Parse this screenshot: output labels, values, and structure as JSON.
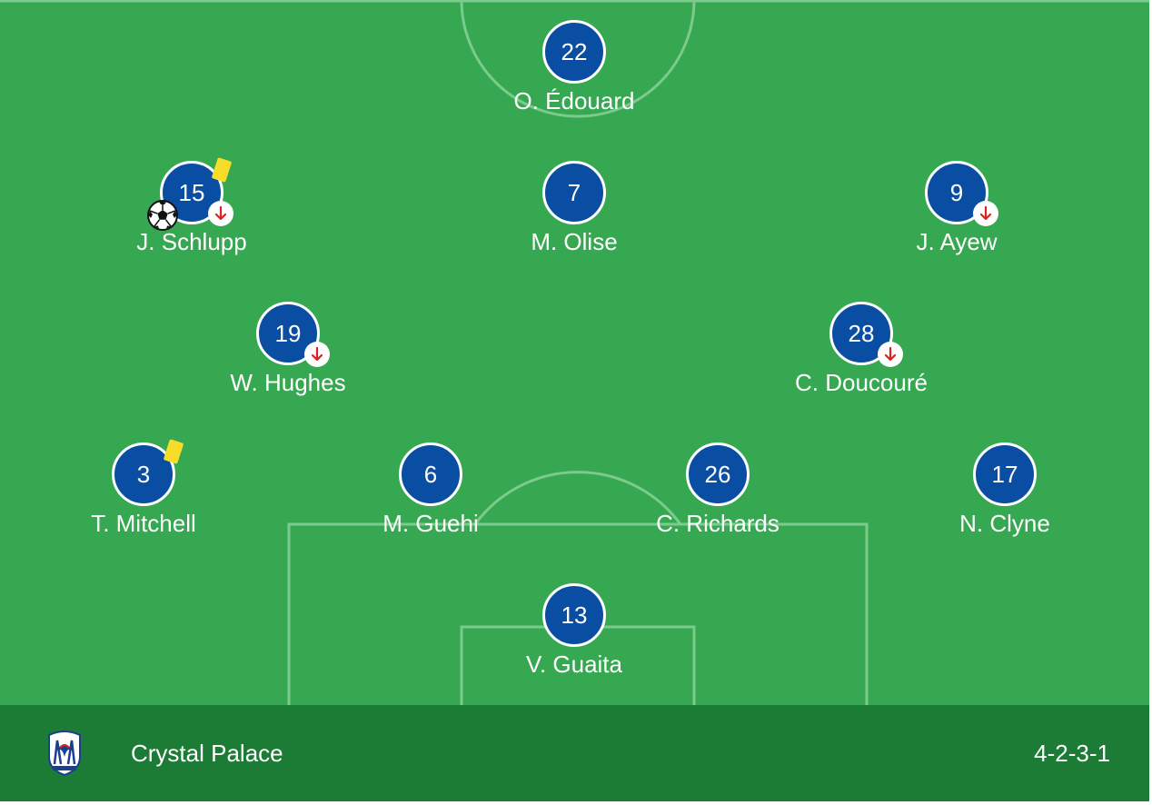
{
  "team": {
    "name": "Crystal Palace",
    "formation": "4-2-3-1"
  },
  "colors": {
    "pitch": "#36a851",
    "footer": "#1c7b35",
    "player_circle": "#0a4ea3",
    "yellow_card": "#f7dc2a",
    "sub_arrow": "#e02020"
  },
  "players": [
    {
      "number": "22",
      "name": "O. Édouard",
      "yellow_card": false,
      "subbed_off": false,
      "goal": false
    },
    {
      "number": "15",
      "name": "J. Schlupp",
      "yellow_card": true,
      "subbed_off": true,
      "goal": true
    },
    {
      "number": "7",
      "name": "M. Olise",
      "yellow_card": false,
      "subbed_off": false,
      "goal": false
    },
    {
      "number": "9",
      "name": "J. Ayew",
      "yellow_card": false,
      "subbed_off": true,
      "goal": false
    },
    {
      "number": "19",
      "name": "W. Hughes",
      "yellow_card": false,
      "subbed_off": true,
      "goal": false
    },
    {
      "number": "28",
      "name": "C. Doucouré",
      "yellow_card": false,
      "subbed_off": true,
      "goal": false
    },
    {
      "number": "3",
      "name": "T. Mitchell",
      "yellow_card": true,
      "subbed_off": false,
      "goal": false
    },
    {
      "number": "6",
      "name": "M. Guehi",
      "yellow_card": false,
      "subbed_off": false,
      "goal": false
    },
    {
      "number": "26",
      "name": "C. Richards",
      "yellow_card": false,
      "subbed_off": false,
      "goal": false
    },
    {
      "number": "17",
      "name": "N. Clyne",
      "yellow_card": false,
      "subbed_off": false,
      "goal": false
    },
    {
      "number": "13",
      "name": "V. Guaita",
      "yellow_card": false,
      "subbed_off": false,
      "goal": false
    }
  ],
  "icons": {
    "crest": "crystal-palace-crest-icon",
    "card": "yellow-card-icon",
    "substitution": "substitution-out-arrow-icon",
    "goal": "football-goal-icon"
  }
}
